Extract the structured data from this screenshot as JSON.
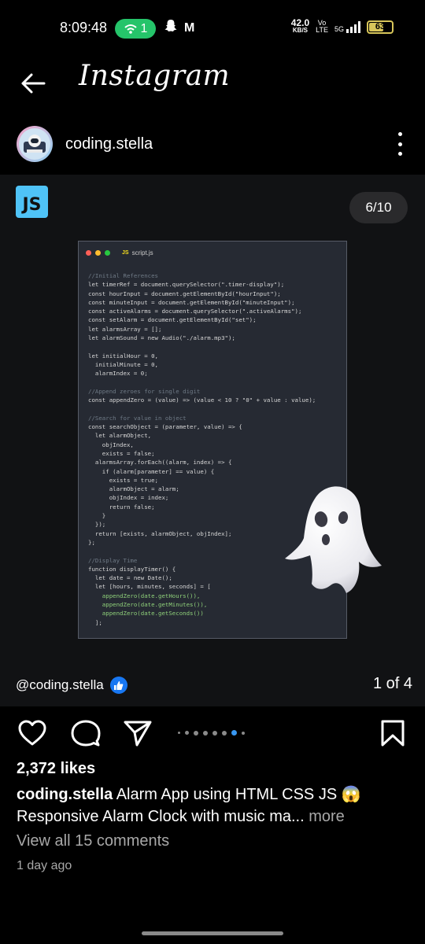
{
  "status_bar": {
    "time": "8:09:48",
    "hotspot_count": "1",
    "carrier_letter": "M",
    "speed_value": "42.0",
    "speed_unit": "KB/S",
    "volte_top": "Vo",
    "volte_bottom": "LTE",
    "network": "5G",
    "battery": "63",
    "battery_level": 0.63,
    "battery_color": "#d8c65a",
    "hotspot_color": "#25c46a"
  },
  "header": {
    "brand": "Instagram",
    "back_icon": "arrow-left-icon"
  },
  "profile": {
    "username": "coding.stella"
  },
  "post": {
    "badge": "JS",
    "slide_counter": "6/10",
    "editor": {
      "filename_badge": "JS",
      "filename": "script.js",
      "lines": [
        {
          "t": "//Initial References",
          "c": "#6f7a86"
        },
        {
          "t": "let timerRef = document.querySelector(\".timer-display\");",
          "c": "#d6d6d6"
        },
        {
          "t": "const hourInput = document.getElementById(\"hourInput\");",
          "c": "#d6d6d6"
        },
        {
          "t": "const minuteInput = document.getElementById(\"minuteInput\");",
          "c": "#d6d6d6"
        },
        {
          "t": "const activeAlarms = document.querySelector(\".activeAlarms\");",
          "c": "#d6d6d6"
        },
        {
          "t": "const setAlarm = document.getElementById(\"set\");",
          "c": "#d6d6d6"
        },
        {
          "t": "let alarmsArray = [];",
          "c": "#d6d6d6"
        },
        {
          "t": "let alarmSound = new Audio(\"./alarm.mp3\");",
          "c": "#d6d6d6"
        },
        {
          "t": "",
          "c": "#d6d6d6"
        },
        {
          "t": "let initialHour = 0,",
          "c": "#d6d6d6"
        },
        {
          "t": "  initialMinute = 0,",
          "c": "#d6d6d6"
        },
        {
          "t": "  alarmIndex = 0;",
          "c": "#d6d6d6"
        },
        {
          "t": "",
          "c": "#d6d6d6"
        },
        {
          "t": "//Append zeroes for single digit",
          "c": "#6f7a86"
        },
        {
          "t": "const appendZero = (value) => (value < 10 ? \"0\" + value : value);",
          "c": "#d6d6d6"
        },
        {
          "t": "",
          "c": "#d6d6d6"
        },
        {
          "t": "//Search for value in object",
          "c": "#6f7a86"
        },
        {
          "t": "const searchObject = (parameter, value) => {",
          "c": "#d6d6d6"
        },
        {
          "t": "  let alarmObject,",
          "c": "#d6d6d6"
        },
        {
          "t": "    objIndex,",
          "c": "#d6d6d6"
        },
        {
          "t": "    exists = false;",
          "c": "#d6d6d6"
        },
        {
          "t": "  alarmsArray.forEach((alarm, index) => {",
          "c": "#d6d6d6"
        },
        {
          "t": "    if (alarm[parameter] == value) {",
          "c": "#d6d6d6"
        },
        {
          "t": "      exists = true;",
          "c": "#d6d6d6"
        },
        {
          "t": "      alarmObject = alarm;",
          "c": "#d6d6d6"
        },
        {
          "t": "      objIndex = index;",
          "c": "#d6d6d6"
        },
        {
          "t": "      return false;",
          "c": "#d6d6d6"
        },
        {
          "t": "    }",
          "c": "#d6d6d6"
        },
        {
          "t": "  });",
          "c": "#d6d6d6"
        },
        {
          "t": "  return [exists, alarmObject, objIndex];",
          "c": "#d6d6d6"
        },
        {
          "t": "};",
          "c": "#d6d6d6"
        },
        {
          "t": "",
          "c": "#d6d6d6"
        },
        {
          "t": "//Display Time",
          "c": "#6f7a86"
        },
        {
          "t": "function displayTimer() {",
          "c": "#d6d6d6"
        },
        {
          "t": "  let date = new Date();",
          "c": "#d6d6d6"
        },
        {
          "t": "  let [hours, minutes, seconds] = [",
          "c": "#d6d6d6"
        },
        {
          "t": "    appendZero(date.getHours()),",
          "c": "#8fd17a"
        },
        {
          "t": "    appendZero(date.getMinutes()),",
          "c": "#8fd17a"
        },
        {
          "t": "    appendZero(date.getSeconds())",
          "c": "#8fd17a"
        },
        {
          "t": "  ];",
          "c": "#d6d6d6"
        }
      ]
    },
    "watermark": "@coding.stella",
    "page_count": "1 of 4",
    "carousel_dots": 8,
    "carousel_active": 6
  },
  "actions": {
    "like_icon": "heart-icon",
    "comment_icon": "comment-icon",
    "share_icon": "send-icon",
    "save_icon": "bookmark-icon",
    "accent": "#3897f0"
  },
  "likes": "2,372 likes",
  "caption": {
    "username": "coding.stella",
    "text": " Alarm App using HTML CSS JS 😱 Responsive Alarm Clock with music ma...",
    "more": " more"
  },
  "comments_link": "View all 15 comments",
  "time_ago": "1 day ago"
}
